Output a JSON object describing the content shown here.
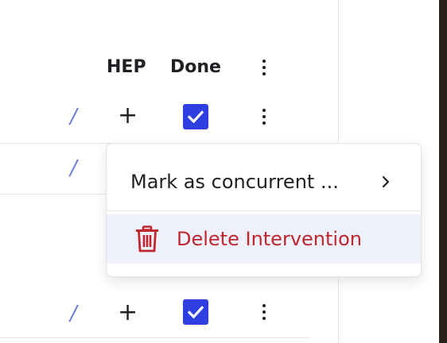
{
  "table": {
    "headers": {
      "hep": "HEP",
      "done": "Done"
    },
    "rows": [
      {
        "slash": "/",
        "plus": "+",
        "done": true
      },
      {
        "slash": "/"
      },
      {
        "slash": "/",
        "plus": "+",
        "done": true
      }
    ]
  },
  "context_menu": {
    "items": [
      {
        "label": "Mark as concurrent ...",
        "icon": "chevron-right-icon"
      },
      {
        "label": "Delete Intervention",
        "icon": "trash-icon",
        "color": "#c0262d"
      }
    ]
  },
  "colors": {
    "accent": "#2d3fde",
    "danger": "#c0262d",
    "link": "#6f7ed6",
    "highlight": "#eef0fb"
  }
}
